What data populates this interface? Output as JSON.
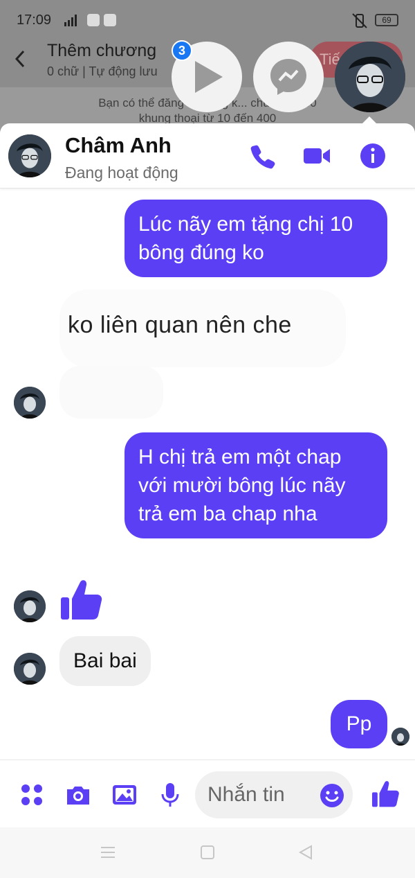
{
  "status_bar": {
    "time": "17:09",
    "battery": "69"
  },
  "background_app": {
    "title": "Thêm chương",
    "subtitle": "0 chữ | Tự động lưu",
    "button_label": "Tiế",
    "note_line1": "Bạn có thể đăng chương k... chữ t... 6000",
    "note_line2": "khung thoại từ 10 đến 400"
  },
  "chat_heads": {
    "badge_count": "3"
  },
  "chat": {
    "contact_name": "Châm Anh",
    "contact_status": "Đang hoạt động",
    "messages": [
      {
        "side": "out",
        "text": "Lúc nãy em tặng chị 10 bông đúng ko"
      },
      {
        "side": "in",
        "text": "ko liên quan nên che"
      },
      {
        "side": "out",
        "text": "H chị trả em một chap với mười bông lúc nãy trả em ba chap nha"
      },
      {
        "side": "in",
        "text": "Bai bai"
      },
      {
        "side": "out",
        "text": "Pp"
      }
    ]
  },
  "composer": {
    "placeholder": "Nhắn tin"
  },
  "colors": {
    "accent": "#5b3ff5",
    "badge": "#1877f2",
    "incoming_bubble": "#efefef"
  }
}
